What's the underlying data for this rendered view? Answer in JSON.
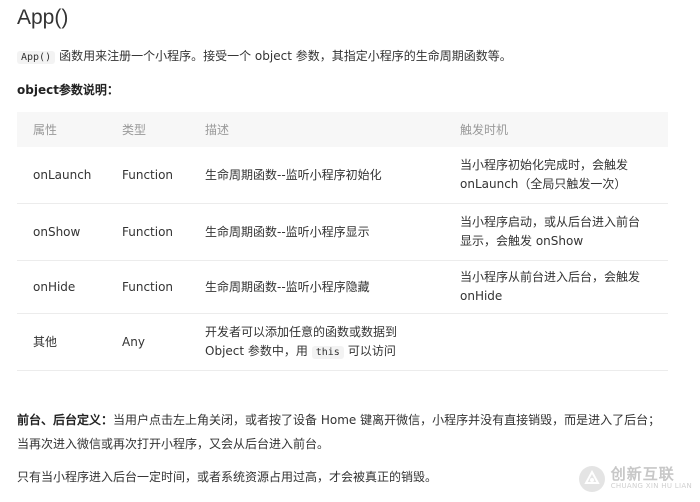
{
  "header": {
    "title": "App()"
  },
  "intro": {
    "code": "App()",
    "text": "函数用来注册一个小程序。接受一个 object 参数，其指定小程序的生命周期函数等。"
  },
  "section": {
    "heading": "object参数说明："
  },
  "table": {
    "headers": [
      "属性",
      "类型",
      "描述",
      "触发时机"
    ],
    "rows": [
      {
        "name": "onLaunch",
        "type": "Function",
        "desc_line1": "生命周期函数--监听小程序初始化",
        "desc_line2": "",
        "trigger_line1": "当小程序初始化完成时，会触发",
        "trigger_line2": "onLaunch（全局只触发一次）"
      },
      {
        "name": "onShow",
        "type": "Function",
        "desc_line1": "生命周期函数--监听小程序显示",
        "desc_line2": "",
        "trigger_line1": "当小程序启动，或从后台进入前台",
        "trigger_line2": "显示，会触发 onShow"
      },
      {
        "name": "onHide",
        "type": "Function",
        "desc_line1": "生命周期函数--监听小程序隐藏",
        "desc_line2": "",
        "trigger_line1": "当小程序从前台进入后台，会触发",
        "trigger_line2": "onHide"
      },
      {
        "name": "其他",
        "type": "Any",
        "desc_line1": "开发者可以添加任意的函数或数据到",
        "desc_line2_pre": "Object 参数中，用",
        "desc_line2_code": "this",
        "desc_line2_post": "可以访问",
        "trigger_line1": "",
        "trigger_line2": ""
      }
    ]
  },
  "paragraphs": {
    "p1_bold": "前台、后台定义：",
    "p1_text": "当用户点击左上角关闭，或者按了设备 Home 键离开微信，小程序并没有直接销毁，而是进入了后台；",
    "p2_text": "当再次进入微信或再次打开小程序，又会从后台进入前台。",
    "p3_text": "只有当小程序进入后台一定时间，或者系统资源占用过高，才会被真正的销毁。"
  },
  "watermark": {
    "main": "创新互联",
    "sub": "CHUANG XIN HU LIAN"
  }
}
